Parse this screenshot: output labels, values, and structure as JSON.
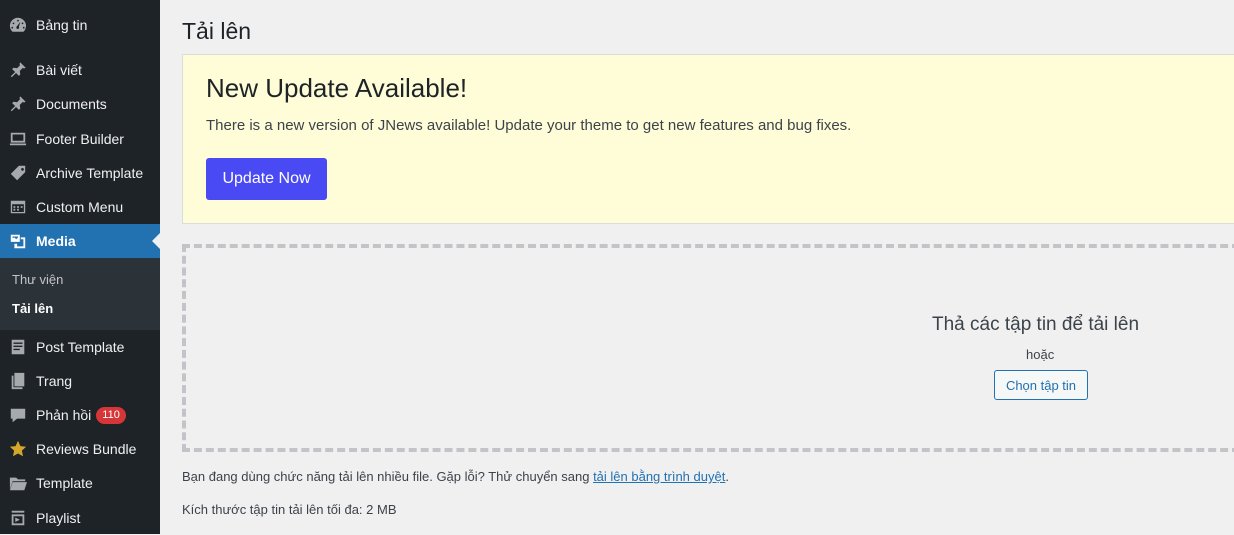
{
  "sidebar": {
    "items": [
      {
        "label": "Bảng tin",
        "icon": "dashboard-icon"
      },
      {
        "label": "Bài viết",
        "icon": "pin-icon"
      },
      {
        "label": "Documents",
        "icon": "pin-icon"
      },
      {
        "label": "Footer Builder",
        "icon": "monitor-icon"
      },
      {
        "label": "Archive Template",
        "icon": "tag-icon"
      },
      {
        "label": "Custom Menu",
        "icon": "calendar-icon"
      },
      {
        "label": "Media",
        "icon": "media-icon"
      },
      {
        "label": "Post Template",
        "icon": "document-icon"
      },
      {
        "label": "Trang",
        "icon": "pages-icon"
      },
      {
        "label": "Phản hồi",
        "icon": "comment-icon",
        "badge": "110"
      },
      {
        "label": "Reviews Bundle",
        "icon": "star-icon"
      },
      {
        "label": "Template",
        "icon": "folder-icon"
      },
      {
        "label": "Playlist",
        "icon": "playlist-icon"
      }
    ],
    "submenu": [
      {
        "label": "Thư viện"
      },
      {
        "label": "Tải lên"
      }
    ],
    "accent": "#2271b1",
    "badge_color": "#d63638"
  },
  "main": {
    "title": "Tải lên",
    "notice": {
      "title": "New Update Available!",
      "text": "There is a new version of JNews available! Update your theme to get new features and bug fixes.",
      "button": "Update Now",
      "button_color": "#4a4af4",
      "background": "#fffdd8"
    },
    "uploader": {
      "drop_text": "Thả các tập tin để tải lên",
      "or_text": "hoặc",
      "select_button": "Chọn tập tin"
    },
    "multi_note": {
      "text": "Bạn đang dùng chức năng tải lên nhiều file. Gặp lỗi? Thử chuyển sang ",
      "link": "tải lên bằng trình duyệt",
      "suffix": "."
    },
    "max_size": "Kích thước tập tin tải lên tối đa: 2 MB"
  }
}
